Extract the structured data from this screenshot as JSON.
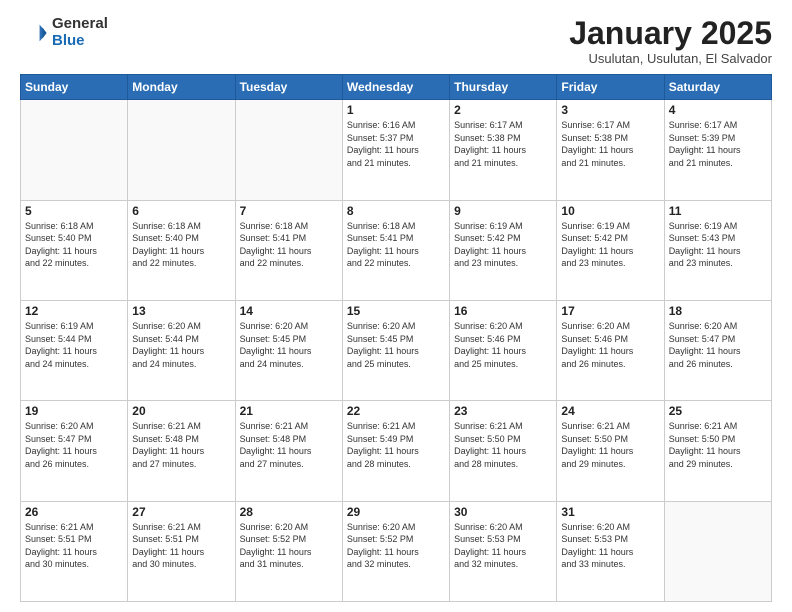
{
  "header": {
    "logo": {
      "general": "General",
      "blue": "Blue"
    },
    "month": "January 2025",
    "location": "Usulutan, Usulutan, El Salvador"
  },
  "weekdays": [
    "Sunday",
    "Monday",
    "Tuesday",
    "Wednesday",
    "Thursday",
    "Friday",
    "Saturday"
  ],
  "weeks": [
    [
      {
        "day": "",
        "info": ""
      },
      {
        "day": "",
        "info": ""
      },
      {
        "day": "",
        "info": ""
      },
      {
        "day": "1",
        "info": "Sunrise: 6:16 AM\nSunset: 5:37 PM\nDaylight: 11 hours\nand 21 minutes."
      },
      {
        "day": "2",
        "info": "Sunrise: 6:17 AM\nSunset: 5:38 PM\nDaylight: 11 hours\nand 21 minutes."
      },
      {
        "day": "3",
        "info": "Sunrise: 6:17 AM\nSunset: 5:38 PM\nDaylight: 11 hours\nand 21 minutes."
      },
      {
        "day": "4",
        "info": "Sunrise: 6:17 AM\nSunset: 5:39 PM\nDaylight: 11 hours\nand 21 minutes."
      }
    ],
    [
      {
        "day": "5",
        "info": "Sunrise: 6:18 AM\nSunset: 5:40 PM\nDaylight: 11 hours\nand 22 minutes."
      },
      {
        "day": "6",
        "info": "Sunrise: 6:18 AM\nSunset: 5:40 PM\nDaylight: 11 hours\nand 22 minutes."
      },
      {
        "day": "7",
        "info": "Sunrise: 6:18 AM\nSunset: 5:41 PM\nDaylight: 11 hours\nand 22 minutes."
      },
      {
        "day": "8",
        "info": "Sunrise: 6:18 AM\nSunset: 5:41 PM\nDaylight: 11 hours\nand 22 minutes."
      },
      {
        "day": "9",
        "info": "Sunrise: 6:19 AM\nSunset: 5:42 PM\nDaylight: 11 hours\nand 23 minutes."
      },
      {
        "day": "10",
        "info": "Sunrise: 6:19 AM\nSunset: 5:42 PM\nDaylight: 11 hours\nand 23 minutes."
      },
      {
        "day": "11",
        "info": "Sunrise: 6:19 AM\nSunset: 5:43 PM\nDaylight: 11 hours\nand 23 minutes."
      }
    ],
    [
      {
        "day": "12",
        "info": "Sunrise: 6:19 AM\nSunset: 5:44 PM\nDaylight: 11 hours\nand 24 minutes."
      },
      {
        "day": "13",
        "info": "Sunrise: 6:20 AM\nSunset: 5:44 PM\nDaylight: 11 hours\nand 24 minutes."
      },
      {
        "day": "14",
        "info": "Sunrise: 6:20 AM\nSunset: 5:45 PM\nDaylight: 11 hours\nand 24 minutes."
      },
      {
        "day": "15",
        "info": "Sunrise: 6:20 AM\nSunset: 5:45 PM\nDaylight: 11 hours\nand 25 minutes."
      },
      {
        "day": "16",
        "info": "Sunrise: 6:20 AM\nSunset: 5:46 PM\nDaylight: 11 hours\nand 25 minutes."
      },
      {
        "day": "17",
        "info": "Sunrise: 6:20 AM\nSunset: 5:46 PM\nDaylight: 11 hours\nand 26 minutes."
      },
      {
        "day": "18",
        "info": "Sunrise: 6:20 AM\nSunset: 5:47 PM\nDaylight: 11 hours\nand 26 minutes."
      }
    ],
    [
      {
        "day": "19",
        "info": "Sunrise: 6:20 AM\nSunset: 5:47 PM\nDaylight: 11 hours\nand 26 minutes."
      },
      {
        "day": "20",
        "info": "Sunrise: 6:21 AM\nSunset: 5:48 PM\nDaylight: 11 hours\nand 27 minutes."
      },
      {
        "day": "21",
        "info": "Sunrise: 6:21 AM\nSunset: 5:48 PM\nDaylight: 11 hours\nand 27 minutes."
      },
      {
        "day": "22",
        "info": "Sunrise: 6:21 AM\nSunset: 5:49 PM\nDaylight: 11 hours\nand 28 minutes."
      },
      {
        "day": "23",
        "info": "Sunrise: 6:21 AM\nSunset: 5:50 PM\nDaylight: 11 hours\nand 28 minutes."
      },
      {
        "day": "24",
        "info": "Sunrise: 6:21 AM\nSunset: 5:50 PM\nDaylight: 11 hours\nand 29 minutes."
      },
      {
        "day": "25",
        "info": "Sunrise: 6:21 AM\nSunset: 5:50 PM\nDaylight: 11 hours\nand 29 minutes."
      }
    ],
    [
      {
        "day": "26",
        "info": "Sunrise: 6:21 AM\nSunset: 5:51 PM\nDaylight: 11 hours\nand 30 minutes."
      },
      {
        "day": "27",
        "info": "Sunrise: 6:21 AM\nSunset: 5:51 PM\nDaylight: 11 hours\nand 30 minutes."
      },
      {
        "day": "28",
        "info": "Sunrise: 6:20 AM\nSunset: 5:52 PM\nDaylight: 11 hours\nand 31 minutes."
      },
      {
        "day": "29",
        "info": "Sunrise: 6:20 AM\nSunset: 5:52 PM\nDaylight: 11 hours\nand 32 minutes."
      },
      {
        "day": "30",
        "info": "Sunrise: 6:20 AM\nSunset: 5:53 PM\nDaylight: 11 hours\nand 32 minutes."
      },
      {
        "day": "31",
        "info": "Sunrise: 6:20 AM\nSunset: 5:53 PM\nDaylight: 11 hours\nand 33 minutes."
      },
      {
        "day": "",
        "info": ""
      }
    ]
  ]
}
